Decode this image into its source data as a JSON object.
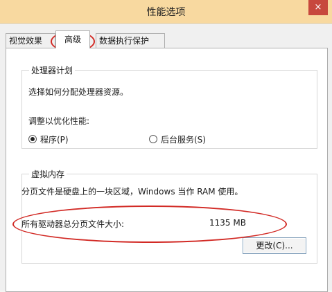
{
  "window": {
    "title": "性能选项",
    "close_symbol": "×"
  },
  "tabs": [
    {
      "label": "视觉效果"
    },
    {
      "label": "高级"
    },
    {
      "label": "数据执行保护"
    }
  ],
  "processor": {
    "group_title": "处理器计划",
    "description": "选择如何分配处理器资源。",
    "adjust_label": "调整以优化性能:",
    "option_programs": "程序(P)",
    "option_background": "后台服务(S)"
  },
  "virtual_memory": {
    "group_title": "虚拟内存",
    "description": "分页文件是硬盘上的一块区域，Windows 当作 RAM 使用。",
    "total_label": "所有驱动器总分页文件大小:",
    "total_value": "1135 MB",
    "change_button": "更改(C)..."
  },
  "colors": {
    "title_bar": "#f8d9a0",
    "close_button": "#c7483d",
    "annotation": "#d22a25"
  }
}
